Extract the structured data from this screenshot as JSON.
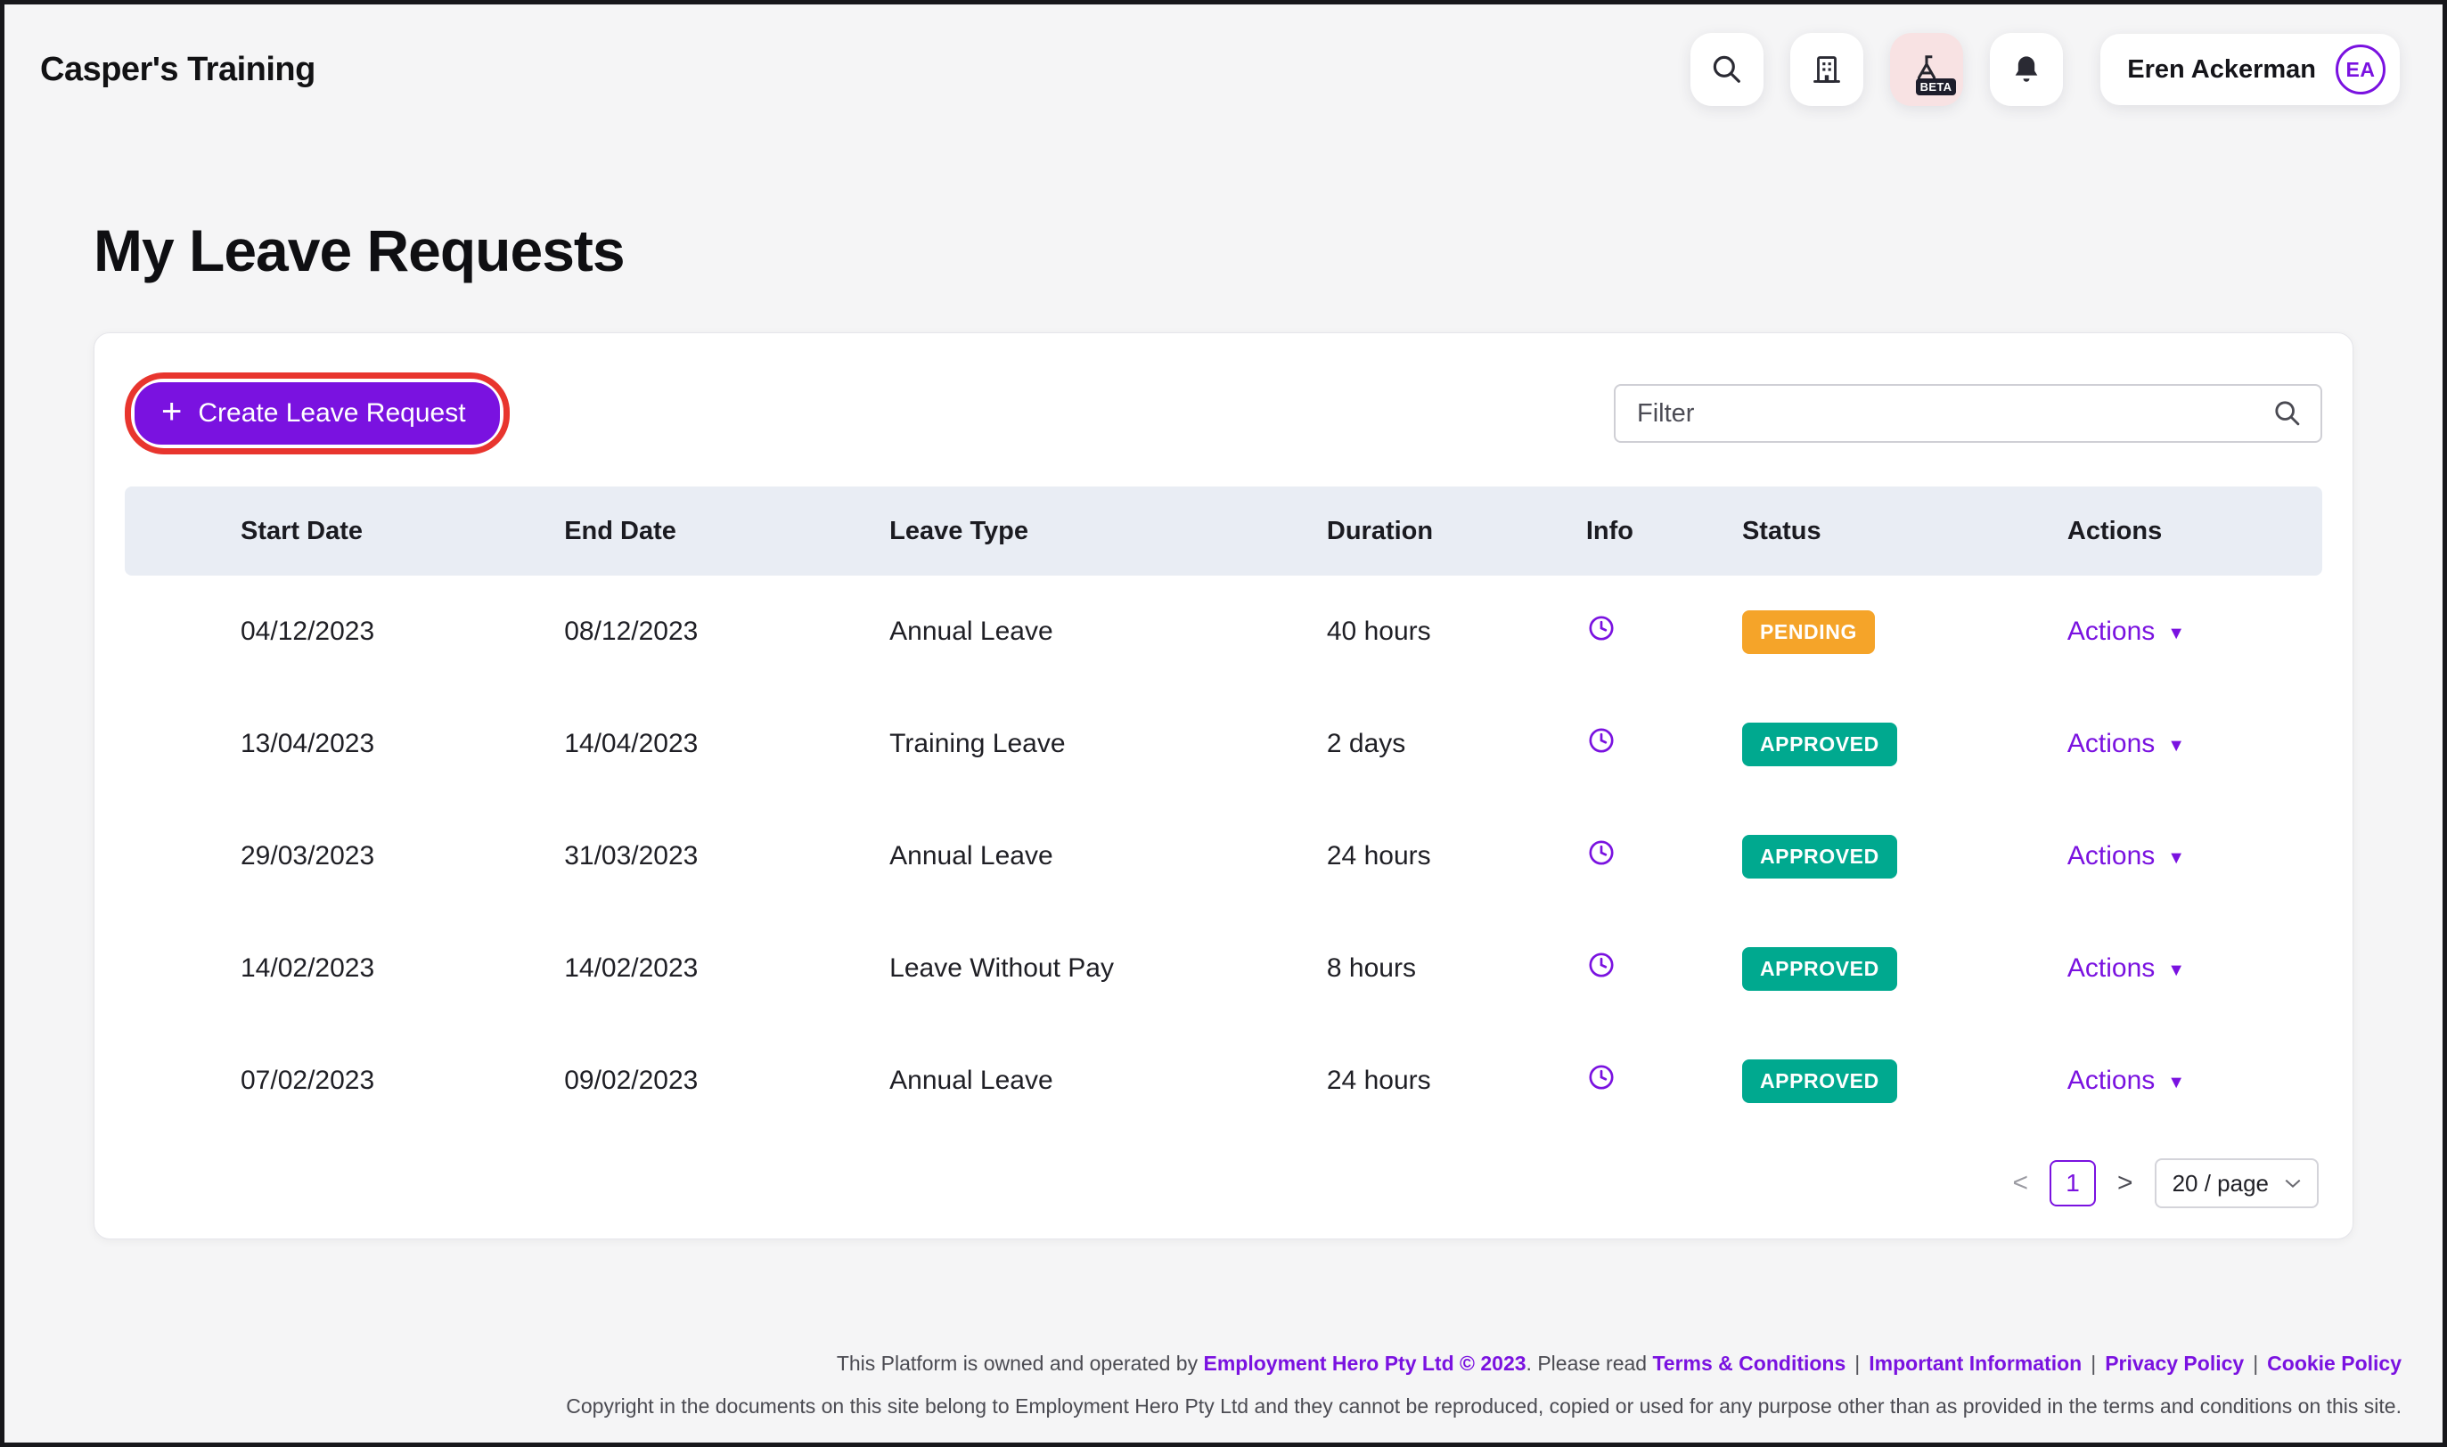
{
  "app": {
    "title": "Casper's Training"
  },
  "header": {
    "beta_label": "BETA",
    "user": {
      "name": "Eren Ackerman",
      "initials": "EA"
    }
  },
  "page": {
    "title": "My Leave Requests"
  },
  "toolbar": {
    "create_button": "Create Leave Request",
    "filter_placeholder": "Filter"
  },
  "icons": {
    "plus": "+",
    "caret_down": "▼"
  },
  "table": {
    "columns": [
      "Start Date",
      "End Date",
      "Leave Type",
      "Duration",
      "Info",
      "Status",
      "Actions"
    ],
    "actions_label": "Actions",
    "rows": [
      {
        "start": "04/12/2023",
        "end": "08/12/2023",
        "type": "Annual Leave",
        "duration": "40 hours",
        "status": "PENDING",
        "status_color": "#F5A429"
      },
      {
        "start": "13/04/2023",
        "end": "14/04/2023",
        "type": "Training Leave",
        "duration": "2 days",
        "status": "APPROVED",
        "status_color": "#00A98F"
      },
      {
        "start": "29/03/2023",
        "end": "31/03/2023",
        "type": "Annual Leave",
        "duration": "24 hours",
        "status": "APPROVED",
        "status_color": "#00A98F"
      },
      {
        "start": "14/02/2023",
        "end": "14/02/2023",
        "type": "Leave Without Pay",
        "duration": "8 hours",
        "status": "APPROVED",
        "status_color": "#00A98F"
      },
      {
        "start": "07/02/2023",
        "end": "09/02/2023",
        "type": "Annual Leave",
        "duration": "24 hours",
        "status": "APPROVED",
        "status_color": "#00A98F"
      }
    ]
  },
  "pagination": {
    "prev": "<",
    "page": "1",
    "next": ">",
    "page_size": "20 / page"
  },
  "footer": {
    "line1_prefix": "This Platform is owned and operated by ",
    "operator_link": "Employment Hero Pty Ltd © 2023",
    "line1_middle": ". Please read ",
    "links": [
      "Terms & Conditions",
      "Important Information",
      "Privacy Policy",
      "Cookie Policy"
    ],
    "separator": "|",
    "line2": "Copyright in the documents on this site belong to Employment Hero Pty Ltd and they cannot be reproduced, copied or used for any purpose other than as provided in the terms and conditions on this site."
  },
  "colors": {
    "accent": "#7A12E0",
    "pending": "#F5A429",
    "approved": "#00A98F",
    "highlight_ring": "#E8352E",
    "table_header_bg": "#E9EDF4"
  }
}
